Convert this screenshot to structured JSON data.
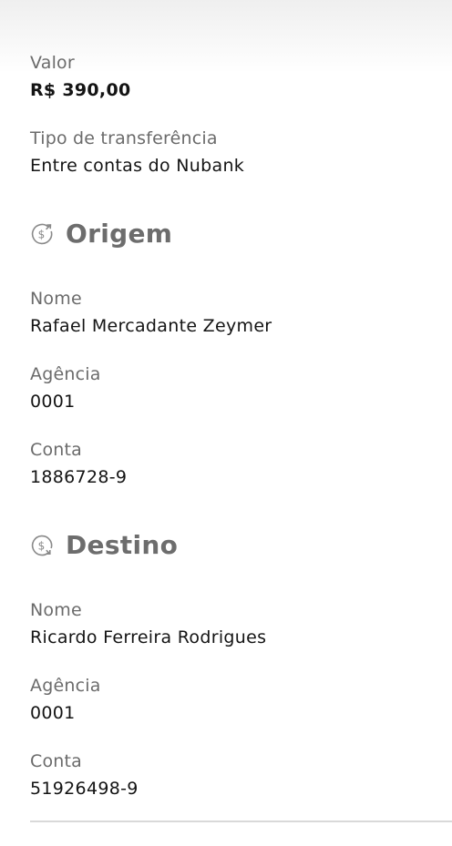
{
  "transfer": {
    "amount_label": "Valor",
    "amount": "R$ 390,00",
    "type_label": "Tipo de transferência",
    "type": "Entre contas do Nubank"
  },
  "origin": {
    "title": "Origem",
    "icon": "money-out-icon",
    "name_label": "Nome",
    "name": "Rafael Mercadante Zeymer",
    "agency_label": "Agência",
    "agency": "0001",
    "account_label": "Conta",
    "account": "1886728-9"
  },
  "destination": {
    "title": "Destino",
    "icon": "money-in-icon",
    "name_label": "Nome",
    "name": "Ricardo Ferreira Rodrigues",
    "agency_label": "Agência",
    "agency": "0001",
    "account_label": "Conta",
    "account": "51926498-9"
  },
  "colors": {
    "label": "#6b6b6b",
    "value": "#141414",
    "section_title": "#6d6d6d"
  }
}
